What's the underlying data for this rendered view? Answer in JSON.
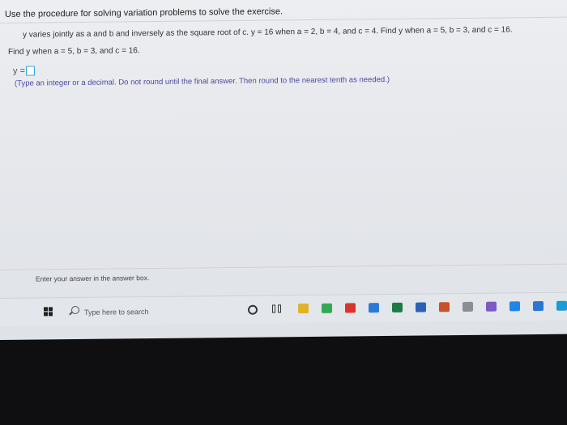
{
  "instruction": "Use the procedure for solving variation problems to solve the exercise.",
  "problem_text": "y varies jointly as a and b and inversely as the square root of c. y = 16 when a = 2, b = 4, and c = 4. Find y when a = 5, b = 3, and c = 16.",
  "find_text": "Find y when a = 5, b = 3, and c = 16.",
  "answer_prefix": "y =",
  "answer_value": "",
  "hint_text": "(Type an integer or a decimal. Do not round until the final answer. Then round to the nearest tenth as needed.)",
  "status_text": "Enter your answer in the answer box.",
  "taskbar": {
    "search_placeholder": "Type here to search",
    "app_icons": [
      {
        "name": "file-explorer-icon",
        "color": "#e0b12a"
      },
      {
        "name": "chrome-icon",
        "color": "#34a853"
      },
      {
        "name": "acrobat-icon",
        "color": "#d9352a"
      },
      {
        "name": "mail-icon",
        "color": "#2a7bd6"
      },
      {
        "name": "excel-icon",
        "color": "#1e7a45"
      },
      {
        "name": "word-icon",
        "color": "#2b62b8"
      },
      {
        "name": "powerpoint-icon",
        "color": "#c8502b"
      },
      {
        "name": "app-icon",
        "color": "#8a8f96"
      },
      {
        "name": "extra-icon",
        "color": "#7b5ac6"
      },
      {
        "name": "dropbox-icon",
        "color": "#1f86e8"
      },
      {
        "name": "onedrive-icon",
        "color": "#2a77d2"
      },
      {
        "name": "edge-icon",
        "color": "#1a9bd7"
      }
    ]
  }
}
